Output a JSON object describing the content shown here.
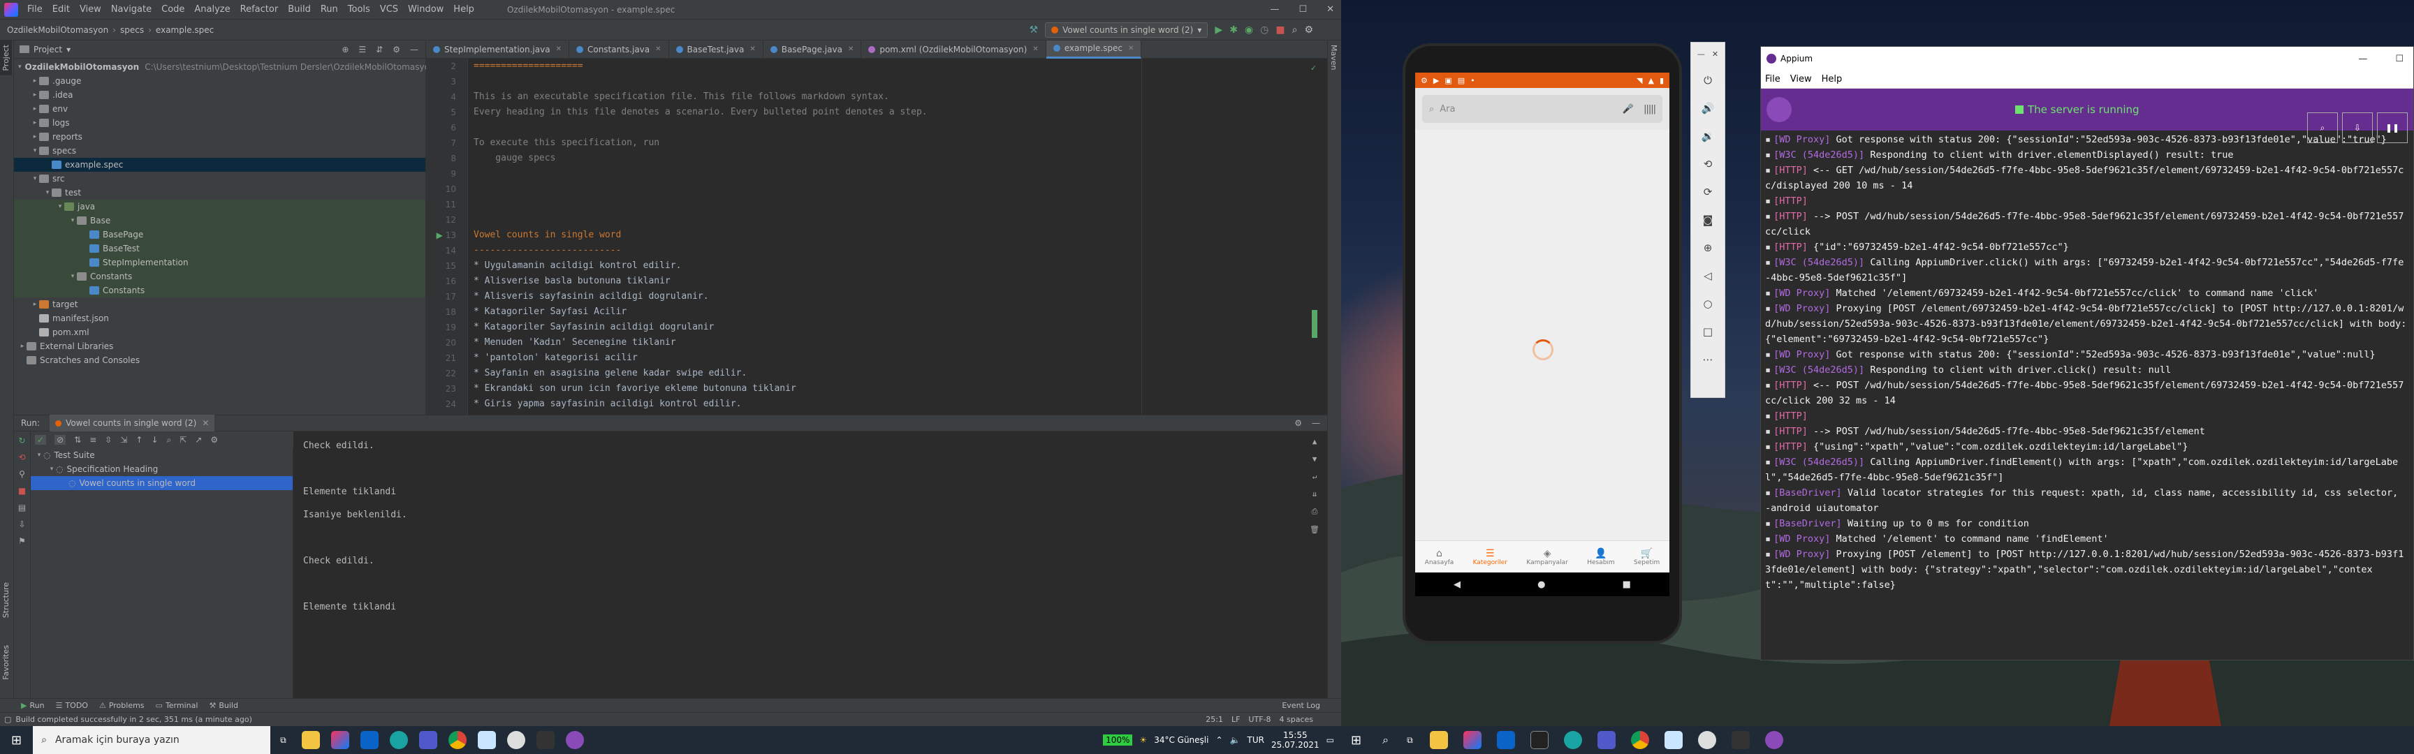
{
  "ide": {
    "title": "OzdilekMobilOtomasyon - example.spec",
    "menu": [
      "File",
      "Edit",
      "View",
      "Navigate",
      "Code",
      "Analyze",
      "Refactor",
      "Build",
      "Run",
      "Tools",
      "VCS",
      "Window",
      "Help"
    ],
    "breadcrumb": [
      "OzdilekMobilOtomasyon",
      "specs",
      "example.spec"
    ],
    "run_config": "Vowel counts in single word (2)",
    "project_header": "Project",
    "tree": [
      {
        "label": "OzdilekMobilOtomasyon",
        "extra": "C:\\Users\\testnium\\Desktop\\Testnium Dersler\\OzdilekMobilOtomasyon",
        "indent": 0,
        "arrow": "▾",
        "color": "#8c8c8c"
      },
      {
        "label": ".gauge",
        "indent": 1,
        "arrow": "▸",
        "color": "#8c8c8c"
      },
      {
        "label": ".idea",
        "indent": 1,
        "arrow": "▸",
        "color": "#8c8c8c"
      },
      {
        "label": "env",
        "indent": 1,
        "arrow": "▸",
        "color": "#8c8c8c"
      },
      {
        "label": "logs",
        "indent": 1,
        "arrow": "▸",
        "color": "#8c8c8c"
      },
      {
        "label": "reports",
        "indent": 1,
        "arrow": "▸",
        "color": "#8c8c8c"
      },
      {
        "label": "specs",
        "indent": 1,
        "arrow": "▾",
        "color": "#8c8c8c"
      },
      {
        "label": "example.spec",
        "indent": 2,
        "arrow": "",
        "color": "#4a88c7",
        "sel": true
      },
      {
        "label": "src",
        "indent": 1,
        "arrow": "▾",
        "color": "#8c8c8c"
      },
      {
        "label": "test",
        "indent": 2,
        "arrow": "▾",
        "color": "#8c8c8c"
      },
      {
        "label": "java",
        "indent": 3,
        "arrow": "▾",
        "color": "#6a8759",
        "hl": true
      },
      {
        "label": "Base",
        "indent": 4,
        "arrow": "▾",
        "color": "#8c8c8c",
        "hl": true
      },
      {
        "label": "BasePage",
        "indent": 5,
        "arrow": "",
        "color": "#4a88c7",
        "hl": true
      },
      {
        "label": "BaseTest",
        "indent": 5,
        "arrow": "",
        "color": "#4a88c7",
        "hl": true
      },
      {
        "label": "StepImplementation",
        "indent": 5,
        "arrow": "",
        "color": "#4a88c7",
        "hl": true
      },
      {
        "label": "Constants",
        "indent": 4,
        "arrow": "▾",
        "color": "#8c8c8c",
        "hl": true
      },
      {
        "label": "Constants",
        "indent": 5,
        "arrow": "",
        "color": "#4a88c7",
        "hl": true
      },
      {
        "label": "target",
        "indent": 1,
        "arrow": "▸",
        "color": "#cc7832"
      },
      {
        "label": "manifest.json",
        "indent": 1,
        "arrow": "",
        "color": "#b0b0b0"
      },
      {
        "label": "pom.xml",
        "indent": 1,
        "arrow": "",
        "color": "#b0b0b0"
      },
      {
        "label": "External Libraries",
        "indent": 0,
        "arrow": "▸",
        "color": "#8c8c8c"
      },
      {
        "label": "Scratches and Consoles",
        "indent": 0,
        "arrow": "",
        "color": "#8c8c8c"
      }
    ],
    "tabs": [
      {
        "label": "StepImplementation.java",
        "color": "#4a88c7"
      },
      {
        "label": "Constants.java",
        "color": "#4a88c7"
      },
      {
        "label": "BaseTest.java",
        "color": "#4a88c7"
      },
      {
        "label": "BasePage.java",
        "color": "#4a88c7"
      },
      {
        "label": "pom.xml (OzdilekMobilOtomasyon)",
        "color": "#b06ac6"
      },
      {
        "label": "example.spec",
        "color": "#4a88c7",
        "active": true
      }
    ],
    "code_lines": [
      {
        "n": "2",
        "text": "====================",
        "cls": "c-sep"
      },
      {
        "n": "3",
        "text": "",
        "cls": ""
      },
      {
        "n": "4",
        "text": "This is an executable specification file. This file follows markdown syntax.",
        "cls": "c-comment"
      },
      {
        "n": "5",
        "text": "Every heading in this file denotes a scenario. Every bulleted point denotes a step.",
        "cls": "c-comment"
      },
      {
        "n": "6",
        "text": "",
        "cls": ""
      },
      {
        "n": "7",
        "text": "To execute this specification, run",
        "cls": "c-comment"
      },
      {
        "n": "8",
        "text": "    gauge specs",
        "cls": "c-comment"
      },
      {
        "n": "9",
        "text": "",
        "cls": ""
      },
      {
        "n": "10",
        "text": "",
        "cls": ""
      },
      {
        "n": "11",
        "text": "",
        "cls": ""
      },
      {
        "n": "12",
        "text": "",
        "cls": ""
      },
      {
        "n": "13",
        "text": "Vowel counts in single word",
        "cls": "c-head"
      },
      {
        "n": "14",
        "text": "---------------------------",
        "cls": "c-sep"
      },
      {
        "n": "15",
        "text": "* Uygulamanin acildigi kontrol edilir.",
        "cls": "c-step"
      },
      {
        "n": "16",
        "text": "* Alisverise basla butonuna tiklanir",
        "cls": "c-step"
      },
      {
        "n": "17",
        "text": "* Alisveris sayfasinin acildigi dogrulanir.",
        "cls": "c-step"
      },
      {
        "n": "18",
        "text": "* Katagoriler Sayfasi Acilir",
        "cls": "c-step"
      },
      {
        "n": "19",
        "text": "* Katagoriler Sayfasinin acildigi dogrulanir",
        "cls": "c-step"
      },
      {
        "n": "20",
        "text": "* Menuden 'Kadın' Secenegine tiklanir",
        "cls": "c-step"
      },
      {
        "n": "21",
        "text": "* 'pantolon' kategorisi acilir",
        "cls": "c-step"
      },
      {
        "n": "22",
        "text": "* Sayfanin en asagisina gelene kadar swipe edilir.",
        "cls": "c-step"
      },
      {
        "n": "23",
        "text": "* Ekrandaki son urun icin favoriye ekleme butonuna tiklanir",
        "cls": "c-step"
      },
      {
        "n": "24",
        "text": "* Giris yapma sayfasinin acildigi kontrol edilir.",
        "cls": "c-step"
      }
    ],
    "run_header": {
      "label": "Run:",
      "config": "Vowel counts in single word (2)"
    },
    "run_tree": [
      {
        "label": "Test Suite",
        "indent": 0
      },
      {
        "label": "Specification Heading",
        "indent": 1
      },
      {
        "label": "Vowel counts in single word",
        "indent": 2,
        "sel": true
      }
    ],
    "console": [
      "Check edildi.",
      "",
      "Elemente tiklandi",
      "Isaniye beklenildi.",
      "",
      "Check edildi.",
      "",
      "Elemente tiklandi"
    ],
    "bottom_tabs": [
      "Run",
      "TODO",
      "Problems",
      "Terminal",
      "Build"
    ],
    "event_log": "Event Log",
    "status_left": "Build completed successfully in 2 sec, 351 ms (a minute ago)",
    "status_right": [
      "25:1",
      "LF",
      "UTF-8",
      "4 spaces"
    ]
  },
  "phone": {
    "status_time": "",
    "search_placeholder": "Ara",
    "nav": [
      {
        "label": "Anasayfa",
        "icon": "home-icon"
      },
      {
        "label": "Kategoriler",
        "icon": "list-icon",
        "active": true
      },
      {
        "label": "Kampanyalar",
        "icon": "tag-icon"
      },
      {
        "label": "Hesabım",
        "icon": "user-icon"
      },
      {
        "label": "Sepetim",
        "icon": "cart-icon"
      }
    ],
    "accent": "#ff6600"
  },
  "appium": {
    "title": "Appium",
    "menu": [
      "File",
      "View",
      "Help"
    ],
    "status": "The server is running",
    "log": [
      {
        "tag": "[WD Proxy]",
        "t": "wd",
        "text": " Got response with status 200: {\"sessionId\":\"52ed593a-903c-4526-8373-b93f13fde01e\",\"value\":\"true\"}"
      },
      {
        "tag": "[W3C (54de26d5)]",
        "t": "wd",
        "text": " Responding to client with driver.elementDisplayed() result: true"
      },
      {
        "tag": "[HTTP]",
        "t": "http",
        "text": " <-- GET /wd/hub/session/54de26d5-f7fe-4bbc-95e8-5def9621c35f/element/69732459-b2e1-4f42-9c54-0bf721e557cc/displayed 200 10 ms - 14"
      },
      {
        "tag": "[HTTP]",
        "t": "http",
        "text": ""
      },
      {
        "tag": "[HTTP]",
        "t": "http",
        "text": " --> POST /wd/hub/session/54de26d5-f7fe-4bbc-95e8-5def9621c35f/element/69732459-b2e1-4f42-9c54-0bf721e557cc/click"
      },
      {
        "tag": "[HTTP]",
        "t": "http",
        "text": " {\"id\":\"69732459-b2e1-4f42-9c54-0bf721e557cc\"}"
      },
      {
        "tag": "[W3C (54de26d5)]",
        "t": "wd",
        "text": " Calling AppiumDriver.click() with args: [\"69732459-b2e1-4f42-9c54-0bf721e557cc\",\"54de26d5-f7fe-4bbc-95e8-5def9621c35f\"]"
      },
      {
        "tag": "[WD Proxy]",
        "t": "wd",
        "text": " Matched '/element/69732459-b2e1-4f42-9c54-0bf721e557cc/click' to command name 'click'"
      },
      {
        "tag": "[WD Proxy]",
        "t": "wd",
        "text": " Proxying [POST /element/69732459-b2e1-4f42-9c54-0bf721e557cc/click] to [POST http://127.0.0.1:8201/wd/hub/session/52ed593a-903c-4526-8373-b93f13fde01e/element/69732459-b2e1-4f42-9c54-0bf721e557cc/click] with body: {\"element\":\"69732459-b2e1-4f42-9c54-0bf721e557cc\"}"
      },
      {
        "tag": "[WD Proxy]",
        "t": "wd",
        "text": " Got response with status 200: {\"sessionId\":\"52ed593a-903c-4526-8373-b93f13fde01e\",\"value\":null}"
      },
      {
        "tag": "[W3C (54de26d5)]",
        "t": "wd",
        "text": " Responding to client with driver.click() result: null"
      },
      {
        "tag": "[HTTP]",
        "t": "http",
        "text": " <-- POST /wd/hub/session/54de26d5-f7fe-4bbc-95e8-5def9621c35f/element/69732459-b2e1-4f42-9c54-0bf721e557cc/click 200 32 ms - 14"
      },
      {
        "tag": "[HTTP]",
        "t": "http",
        "text": ""
      },
      {
        "tag": "[HTTP]",
        "t": "http",
        "text": " --> POST /wd/hub/session/54de26d5-f7fe-4bbc-95e8-5def9621c35f/element"
      },
      {
        "tag": "[HTTP]",
        "t": "http",
        "text": " {\"using\":\"xpath\",\"value\":\"com.ozdilek.ozdilekteyim:id/largeLabel\"}"
      },
      {
        "tag": "[W3C (54de26d5)]",
        "t": "wd",
        "text": " Calling AppiumDriver.findElement() with args: [\"xpath\",\"com.ozdilek.ozdilekteyim:id/largeLabel\",\"54de26d5-f7fe-4bbc-95e8-5def9621c35f\"]"
      },
      {
        "tag": "[BaseDriver]",
        "t": "wd",
        "text": " Valid locator strategies for this request: xpath, id, class name, accessibility id, css selector, -android uiautomator"
      },
      {
        "tag": "[BaseDriver]",
        "t": "wd",
        "text": " Waiting up to 0 ms for condition"
      },
      {
        "tag": "[WD Proxy]",
        "t": "wd",
        "text": " Matched '/element' to command name 'findElement'"
      },
      {
        "tag": "[WD Proxy]",
        "t": "wd",
        "text": " Proxying [POST /element] to [POST http://127.0.0.1:8201/wd/hub/session/52ed593a-903c-4526-8373-b93f13fde01e/element] with body: {\"strategy\":\"xpath\",\"selector\":\"com.ozdilek.ozdilekteyim:id/largeLabel\",\"context\":\"\",\"multiple\":false}"
      }
    ]
  },
  "taskbar": {
    "search_placeholder": "Aramak için buraya yazın",
    "battery": "100%",
    "weather": "34°C  Güneşli",
    "lang": "TUR",
    "time": "15:55",
    "date": "25.07.2021"
  }
}
